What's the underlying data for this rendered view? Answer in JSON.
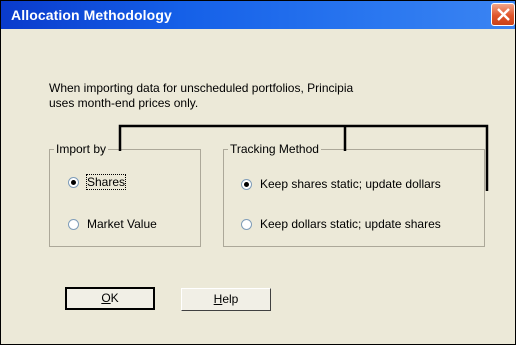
{
  "window": {
    "title": "Allocation Methodology",
    "close_icon": "close-icon"
  },
  "description": {
    "line1": "When importing data for unscheduled portfolios, Principia",
    "line2": "uses month-end prices only."
  },
  "import_by": {
    "label": "Import by",
    "options": [
      {
        "label": "Shares",
        "checked": true
      },
      {
        "label": "Market Value",
        "checked": false
      }
    ]
  },
  "tracking_method": {
    "label": "Tracking Method",
    "options": [
      {
        "label": "Keep shares static; update dollars",
        "checked": true
      },
      {
        "label": "Keep dollars static; update shares",
        "checked": false
      }
    ]
  },
  "buttons": {
    "ok_mnemonic": "O",
    "ok_rest": "K",
    "help_mnemonic": "H",
    "help_rest": "elp"
  },
  "colors": {
    "titlebar": "#0a3bcc",
    "dialog_bg": "#ece9d8",
    "close_button": "#e0552b"
  }
}
